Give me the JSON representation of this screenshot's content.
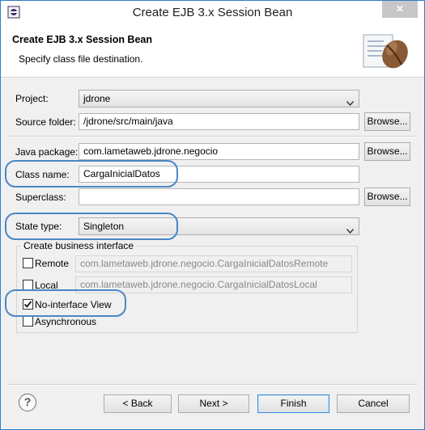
{
  "window": {
    "title": "Create EJB 3.x Session Bean",
    "close_label": "✕"
  },
  "header": {
    "title": "Create EJB 3.x Session Bean",
    "subtitle": "Specify class file destination."
  },
  "form": {
    "project_label": "Project:",
    "project_value": "jdrone",
    "source_folder_label": "Source folder:",
    "source_folder_value": "/jdrone/src/main/java",
    "java_package_label": "Java package:",
    "java_package_value": "com.lametaweb.jdrone.negocio",
    "class_name_label": "Class name:",
    "class_name_value": "CargaInicialDatos",
    "superclass_label": "Superclass:",
    "superclass_value": "",
    "state_type_label": "State type:",
    "state_type_value": "Singleton",
    "browse_label": "Browse..."
  },
  "business_interface": {
    "title": "Create business interface",
    "remote_label": "Remote",
    "remote_checked": false,
    "remote_value": "com.lametaweb.jdrone.negocio.CargaInicialDatosRemote",
    "local_label": "Local",
    "local_checked": false,
    "local_value": "com.lametaweb.jdrone.negocio.CargaInicialDatosLocal",
    "no_interface_label": "No-interface View",
    "no_interface_checked": true,
    "async_label": "Asynchronous",
    "async_checked": false
  },
  "footer": {
    "help_label": "?",
    "back_label": "< Back",
    "next_label": "Next >",
    "finish_label": "Finish",
    "cancel_label": "Cancel"
  },
  "colors": {
    "highlight": "#4a86c8",
    "window_border": "#2c7ec9",
    "default_button_border": "#3b8bd8"
  }
}
